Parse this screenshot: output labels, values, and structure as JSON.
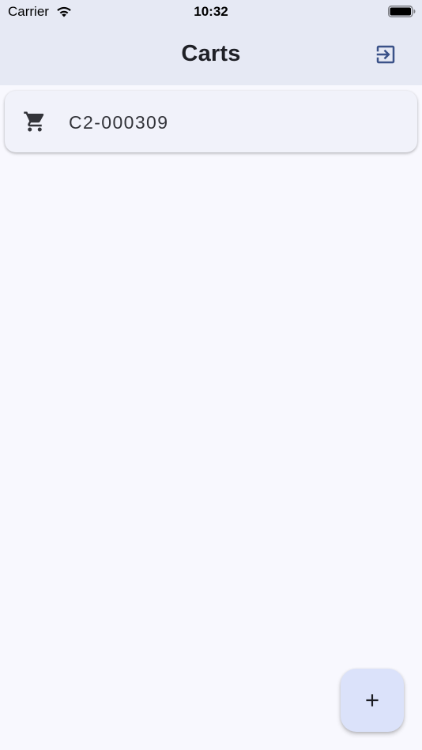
{
  "status_bar": {
    "carrier": "Carrier",
    "time": "10:32",
    "wifi_icon": "wifi-icon",
    "battery_icon": "battery-icon"
  },
  "app_bar": {
    "title": "Carts",
    "action_icon": "logout-icon"
  },
  "carts": [
    {
      "icon": "shopping-cart-icon",
      "label": "C2-000309"
    }
  ],
  "fab": {
    "icon": "plus-icon"
  },
  "colors": {
    "background": "#f8f8fe",
    "app_bar": "#e6e9f4",
    "card": "#f1f2fa",
    "fab": "#dbe2fa",
    "accent": "#3b5288"
  }
}
